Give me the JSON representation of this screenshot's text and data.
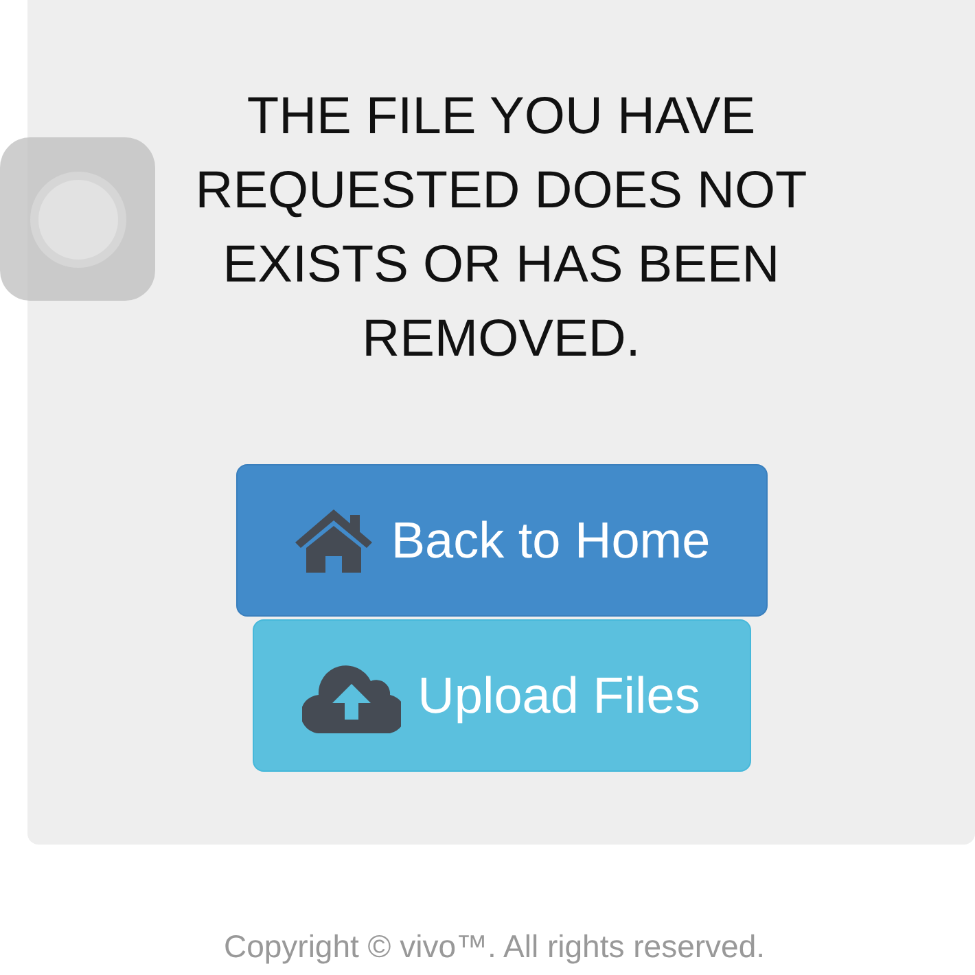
{
  "message": "THE FILE YOU HAVE REQUESTED DOES NOT EXISTS OR HAS BEEN REMOVED.",
  "buttons": [
    {
      "kind": "home",
      "label": "Back to Home"
    },
    {
      "kind": "upload",
      "label": "Upload Files"
    }
  ],
  "footer": "Copyright © vivo™. All rights reserved."
}
